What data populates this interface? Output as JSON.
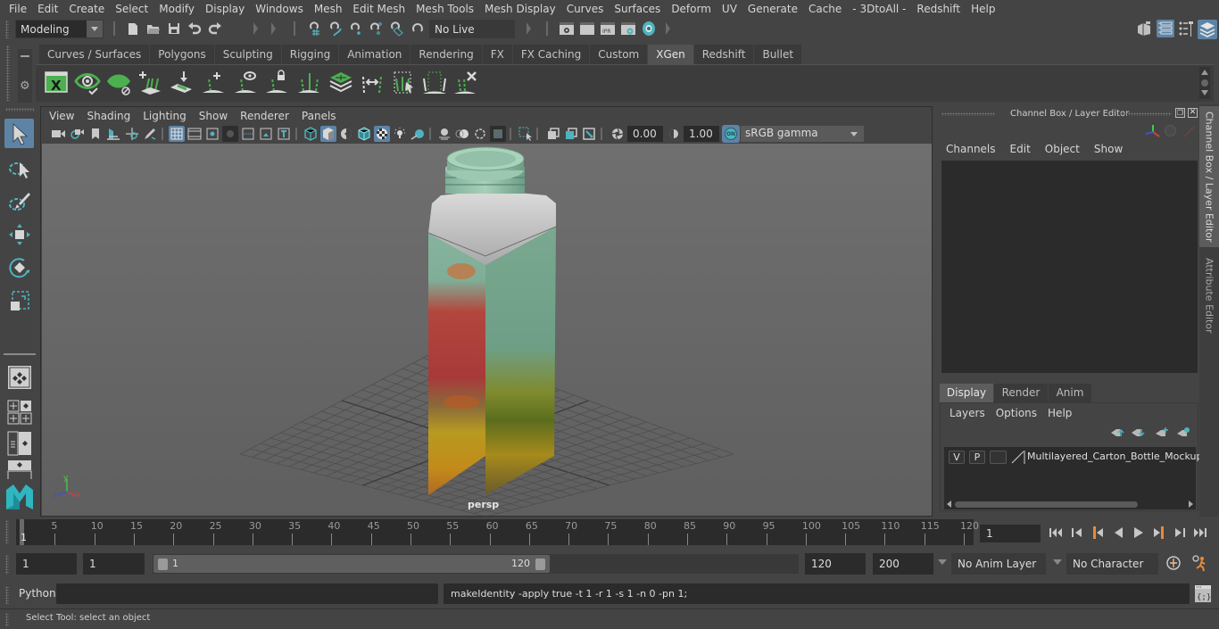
{
  "menubar": {
    "items": [
      "File",
      "Edit",
      "Create",
      "Select",
      "Modify",
      "Display",
      "Windows",
      "Mesh",
      "Edit Mesh",
      "Mesh Tools",
      "Mesh Display",
      "Curves",
      "Surfaces",
      "Deform",
      "UV",
      "Generate",
      "Cache",
      "- 3DtoAll -",
      "Redshift",
      "Help"
    ]
  },
  "statusline": {
    "workspace_mode": "Modeling",
    "live_surface": "No Live Surface",
    "icons": [
      "new-scene-icon",
      "open-scene-icon",
      "save-scene-icon",
      "undo-icon",
      "redo-icon",
      "select-by-hierarchy-icon",
      "select-by-object-icon",
      "select-by-component-icon",
      "snap-to-grid-icon",
      "snap-to-curve-icon",
      "snap-to-point-icon",
      "snap-to-view-plane-icon",
      "make-live-icon",
      "render-view-icon",
      "render-current-frame-icon",
      "ipr-render-icon",
      "render-settings-icon",
      "hypershade-icon"
    ],
    "right_icons": [
      "modeling-toolkit-icon",
      "attribute-editor-toggle-icon",
      "tool-settings-icon",
      "channel-box-toggle-icon"
    ]
  },
  "shelf": {
    "tabs": [
      "Curves / Surfaces",
      "Polygons",
      "Sculpting",
      "Rigging",
      "Animation",
      "Rendering",
      "FX",
      "FX Caching",
      "Custom",
      "XGen",
      "Redshift",
      "Bullet"
    ],
    "active_tab": "XGen",
    "icons": [
      "xgen-editor-icon",
      "xgen-preview-icon",
      "xgen-clear-preview-icon",
      "xgen-add-guides-icon",
      "xgen-place-guides-icon",
      "xgen-add-guide-icon",
      "xgen-show-guides-icon",
      "xgen-lock-guides-icon",
      "xgen-sculpt-guides-icon",
      "xgen-bake-icon",
      "xgen-flip-guides-icon",
      "xgen-select-guides-icon",
      "xgen-guide-box-icon",
      "xgen-delete-guides-icon"
    ]
  },
  "toolbox": {
    "tools": [
      "select-tool",
      "lasso-tool",
      "paint-select-tool",
      "move-tool",
      "rotate-tool",
      "scale-tool"
    ],
    "layouts": [
      "single-perspective-layout",
      "four-view-layout",
      "outliner-persp-layout",
      "persp-graph-layout"
    ]
  },
  "viewport": {
    "menus": [
      "View",
      "Shading",
      "Lighting",
      "Show",
      "Renderer",
      "Panels"
    ],
    "exposure": "0.00",
    "gamma": "1.00",
    "color_mgmt_badge": "ON",
    "color_space": "sRGB gamma",
    "camera_label": "persp",
    "axis_labels": {
      "x": "x",
      "y": "y",
      "z": "z"
    }
  },
  "channel_box": {
    "title": "Channel Box / Layer Editor",
    "menus": [
      "Channels",
      "Edit",
      "Object",
      "Show"
    ],
    "side_tabs": [
      "Channel Box / Layer Editor",
      "Attribute Editor"
    ]
  },
  "layer_editor": {
    "tabs": [
      "Display",
      "Render",
      "Anim"
    ],
    "active_tab": "Display",
    "menus": [
      "Layers",
      "Options",
      "Help"
    ],
    "layers": [
      {
        "visible": "V",
        "playback": "P",
        "type": "",
        "name": "Multilayered_Carton_Bottle_Mockup_"
      }
    ]
  },
  "timeslider": {
    "ticks": [
      5,
      10,
      15,
      20,
      25,
      30,
      35,
      40,
      45,
      50,
      55,
      60,
      65,
      70,
      75,
      80,
      85,
      90,
      95,
      100,
      105,
      110,
      115,
      120
    ],
    "start_label": "1",
    "range": [
      1,
      120
    ],
    "current_frame": "1",
    "playback_buttons": [
      "go-to-start-icon",
      "step-back-frame-icon",
      "step-back-key-icon",
      "play-backwards-icon",
      "play-forwards-icon",
      "step-forward-key-icon",
      "step-forward-frame-icon",
      "go-to-end-icon"
    ]
  },
  "rangeslider": {
    "start_time": "1",
    "playback_start": "1",
    "range_start_label": "1",
    "range_end_label": "120",
    "playback_end": "120",
    "end_time": "200",
    "anim_layer": "No Anim Layer",
    "character_set": "No Character Set"
  },
  "cmdline": {
    "language": "Python",
    "input_value": "",
    "result": "makeIdentity -apply true -t 1 -r 1 -s 1 -n 0 -pn 1;"
  },
  "helpline": {
    "text": "Select Tool: select an object"
  },
  "colors": {
    "accent_blue": "#5d84a6",
    "teal": "#4fb3bf",
    "xgen_green": "#4caf50",
    "playhead_orange": "#e8893a"
  }
}
